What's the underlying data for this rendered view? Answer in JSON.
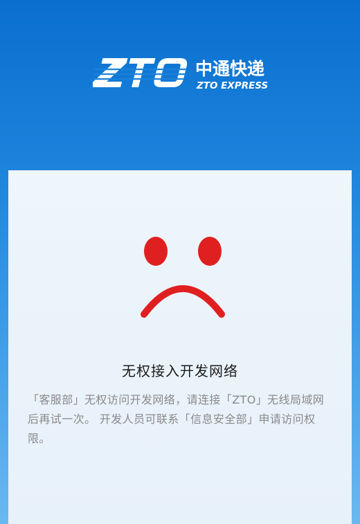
{
  "logo": {
    "mark": "ZTO",
    "name_cn": "中通快递",
    "name_en": "ZTO EXPRESS"
  },
  "error": {
    "icon": "sad-face-icon",
    "title": "无权接入开发网络",
    "message": "「客服部」无权访问开发网络，请连接「ZTO」无线局域网后再试一次。 开发人员可联系「信息安全部」申请访问权限。"
  },
  "colors": {
    "header_blue": "#0a6fcf",
    "icon_red": "#e02020",
    "panel_bg": "#eef5fb",
    "message_gray": "#8a8a8a"
  }
}
